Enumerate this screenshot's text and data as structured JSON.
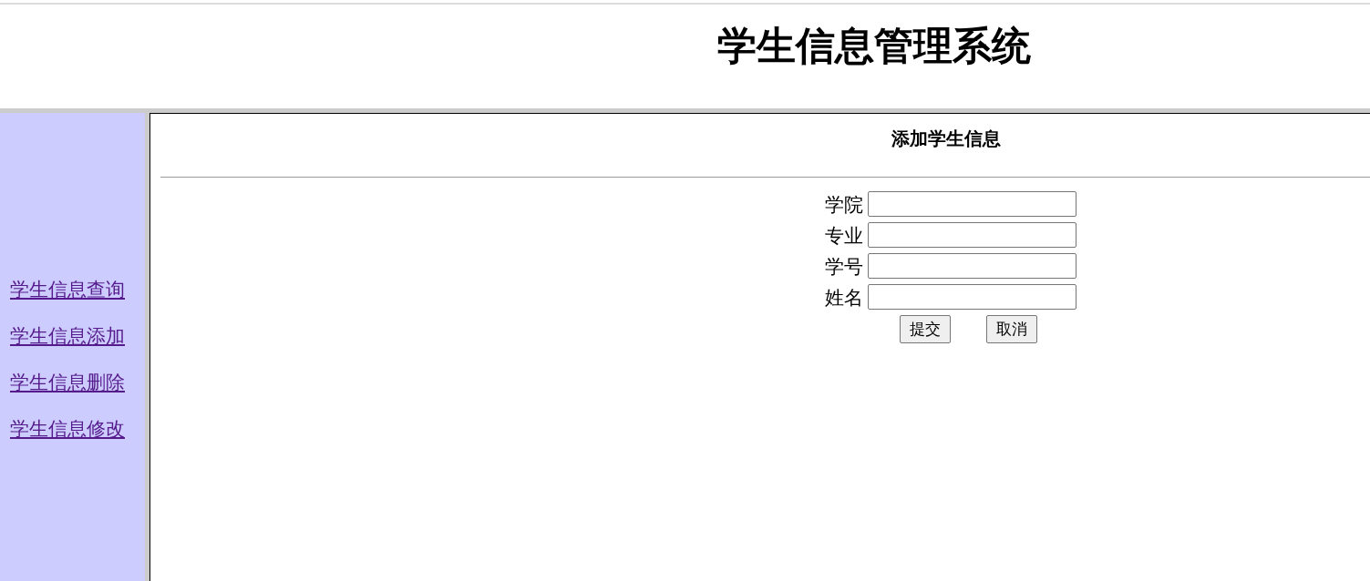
{
  "header": {
    "title": "学生信息管理系统"
  },
  "sidebar": {
    "links": [
      {
        "label": "学生信息查询"
      },
      {
        "label": "学生信息添加"
      },
      {
        "label": "学生信息删除"
      },
      {
        "label": "学生信息修改"
      }
    ]
  },
  "form": {
    "title": "添加学生信息",
    "fields": [
      {
        "label": "学院"
      },
      {
        "label": "专业"
      },
      {
        "label": "学号"
      },
      {
        "label": "姓名"
      }
    ],
    "buttons": [
      {
        "label": "提交"
      },
      {
        "label": "取消"
      }
    ]
  }
}
